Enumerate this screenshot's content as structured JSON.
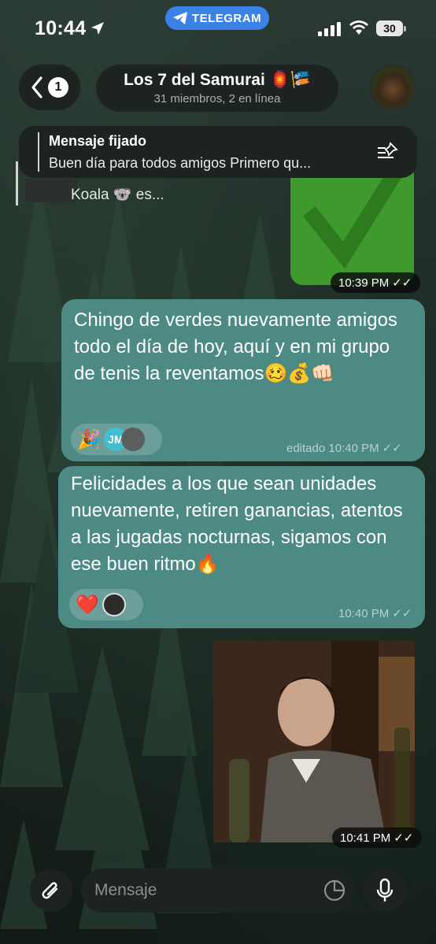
{
  "status_bar": {
    "time": "10:44",
    "app_pill": "TELEGRAM",
    "battery": "30"
  },
  "header": {
    "back_count": "1",
    "title": "Los 7 del Samurai 🏮🎏",
    "subtitle": "31 miembros, 2 en línea"
  },
  "pinned": {
    "label": "Mensaje fijado",
    "text": "Buen día para todos amigos Primero qu..."
  },
  "previous_fragment": {
    "text": "Koala 🐨 es..."
  },
  "messages": [
    {
      "type": "image",
      "icon": "checkmark-icon",
      "time": "10:39 PM"
    },
    {
      "type": "text",
      "text": "Chingo de verdes nuevamente amigos todo el día de hoy, aquí y en mi grupo de tenis la reventamos🥴💰👊🏻",
      "reactions": [
        {
          "emoji": "🎉"
        },
        {
          "initials": "JM",
          "color": "#3fbfd0"
        },
        {
          "avatar": "photo"
        }
      ],
      "meta": "editado 10:40 PM"
    },
    {
      "type": "text",
      "text": "Felicidades a los que sean unidades nuevamente, retiren ganancias, atentos a las jugadas nocturnas, sigamos con ese buen ritmo🔥",
      "reactions": [
        {
          "emoji": "❤️"
        },
        {
          "avatar": "photo"
        }
      ],
      "meta": "10:40 PM"
    },
    {
      "type": "gif",
      "time": "10:41 PM"
    }
  ],
  "composer": {
    "placeholder": "Mensaje"
  },
  "colors": {
    "bubble": "#4e8a84",
    "pill": "#1c2320",
    "telegram_blue": "#3b82e8",
    "check_green": "#3f9a2e"
  }
}
